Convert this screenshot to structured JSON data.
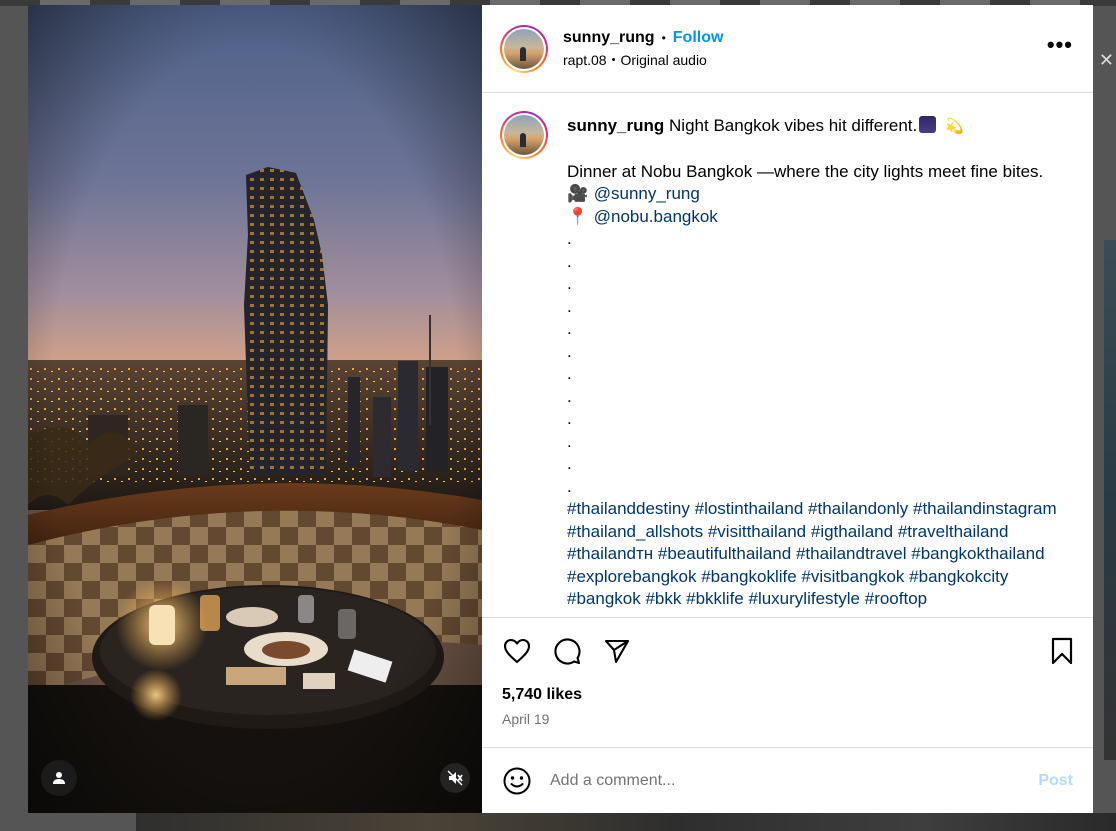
{
  "colors": {
    "accent": "#0095f6",
    "link": "#00376b",
    "muted": "#737373",
    "post_disabled": "#b3dbff",
    "divider": "#dbdbdb"
  },
  "header": {
    "username": "sunny_rung",
    "separator": "•",
    "follow_label": "Follow",
    "audio_user": "rapt.08",
    "audio_sep": "•",
    "audio_label": "Original audio",
    "more_icon": "more-horizontal-icon"
  },
  "caption": {
    "username": "sunny_rung",
    "first_line": "Night Bangkok vibes hit different.",
    "first_line_emojis": [
      "night-city-emoji",
      "dizzy-emoji"
    ],
    "body_line": "Dinner at Nobu Bangkok —where the city lights meet fine bites.",
    "credit_video": "@sunny_rung",
    "credit_video_icon": "movie-camera-emoji",
    "credit_location": "@nobu.bangkok",
    "credit_location_icon": "round-pushpin-emoji",
    "dots": [
      ".",
      ".",
      ".",
      ".",
      ".",
      ".",
      ".",
      ".",
      ".",
      ".",
      ".",
      "."
    ],
    "hashtags": [
      "#thailanddestiny",
      "#lostinthailand",
      "#thailandonly",
      "#thailandinstagram",
      "#thailand_allshots",
      "#visitthailand",
      "#igthailand",
      "#travelthailand",
      "#thailandтн",
      "#beautifulthailand",
      "#thailandtravel",
      "#bangkokthailand",
      "#explorebangkok",
      "#bangkoklife",
      "#visitbangkok",
      "#bangkokcity",
      "#bangkok",
      "#bkk",
      "#bkklife",
      "#luxurylifestyle",
      "#rooftop"
    ]
  },
  "actions": {
    "like_icon": "heart-icon",
    "comment_icon": "comment-bubble-icon",
    "share_icon": "paper-plane-icon",
    "save_icon": "bookmark-icon",
    "likes": "5,740 likes",
    "date": "April 19"
  },
  "comment": {
    "placeholder": "Add a comment...",
    "post_label": "Post",
    "emoji_icon": "smiley-face-icon"
  },
  "media": {
    "tag_icon": "user-tag-icon",
    "mute_icon": "speaker-muted-icon"
  }
}
